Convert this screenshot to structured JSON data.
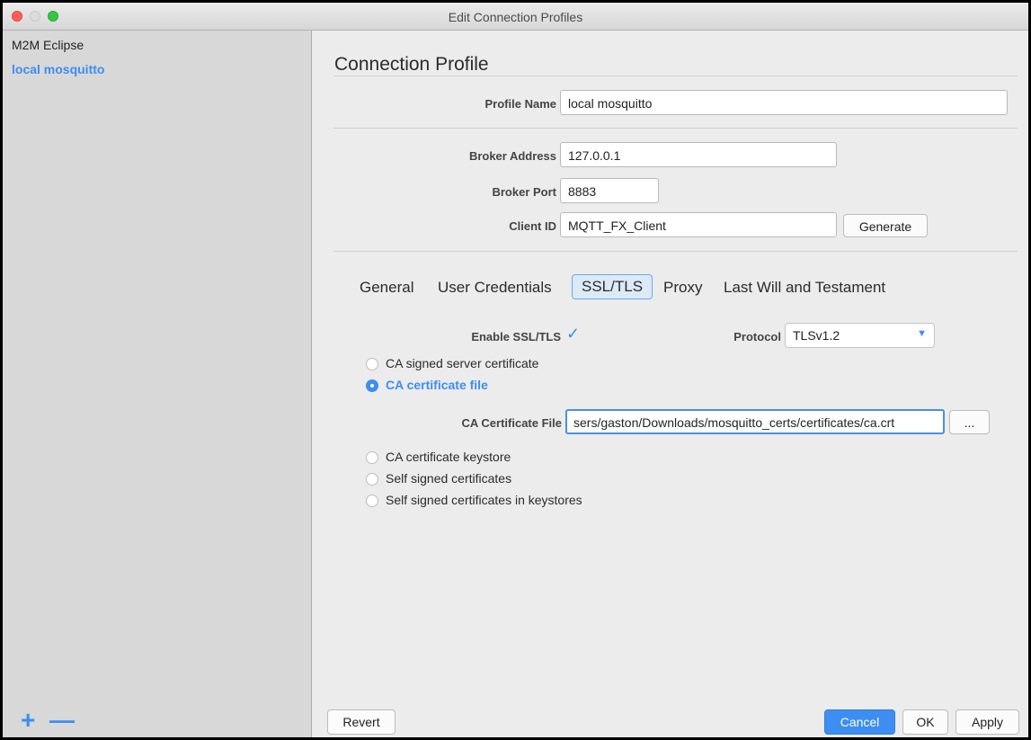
{
  "window": {
    "title": "Edit Connection Profiles"
  },
  "sidebar": {
    "profiles": [
      {
        "label": "M2M Eclipse",
        "active": false
      },
      {
        "label": "local mosquitto",
        "active": true
      }
    ],
    "add_icon": "+",
    "remove_icon": "—"
  },
  "main": {
    "heading": "Connection Profile",
    "profile_name": {
      "label": "Profile Name",
      "value": "local mosquitto"
    },
    "broker_address": {
      "label": "Broker Address",
      "value": "127.0.0.1"
    },
    "broker_port": {
      "label": "Broker Port",
      "value": "8883"
    },
    "client_id": {
      "label": "Client ID",
      "value": "MQTT_FX_Client",
      "generate_label": "Generate"
    },
    "tabs": [
      "General",
      "User Credentials",
      "SSL/TLS",
      "Proxy",
      "Last Will and Testament"
    ],
    "active_tab": "SSL/TLS",
    "ssl": {
      "enable_label": "Enable SSL/TLS",
      "enable_check": "✓",
      "protocol_label": "Protocol",
      "protocol_value": "TLSv1.2",
      "protocol_caret": "▼",
      "options": [
        "CA signed server certificate",
        "CA certificate file",
        "CA certificate keystore",
        "Self signed certificates",
        "Self signed certificates in keystores"
      ],
      "selected_option": "CA certificate file",
      "ca_file_label": "CA Certificate File",
      "ca_file_value": "sers/gaston/Downloads/mosquitto_certs/certificates/ca.crt",
      "browse_label": "..."
    },
    "footer": {
      "revert": "Revert",
      "cancel": "Cancel",
      "ok": "OK",
      "apply": "Apply"
    }
  },
  "colors": {
    "accent": "#3d8ef0",
    "close": "#fc5f57",
    "maximize": "#33c748"
  }
}
